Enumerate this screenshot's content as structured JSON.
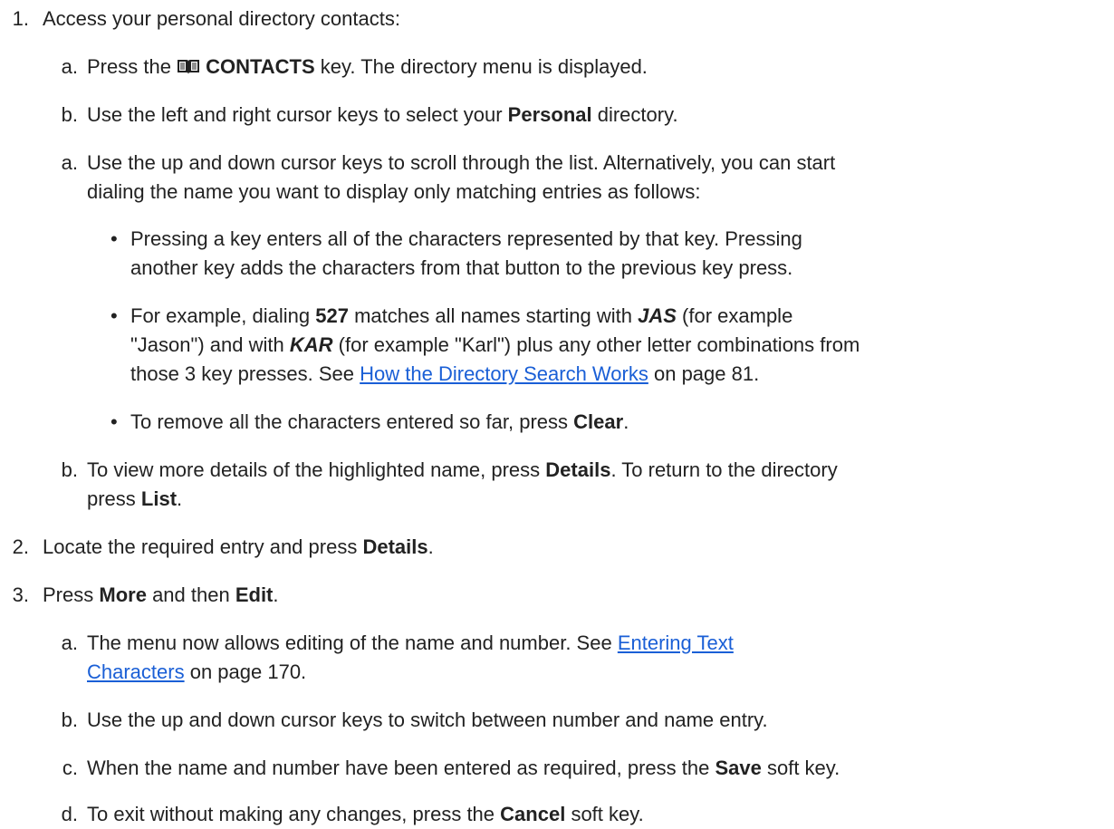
{
  "steps": {
    "s1": {
      "num": "1.",
      "text": "Access your personal directory contacts:",
      "a": {
        "letter": "a.",
        "pre": "Press the",
        "key": "CONTACTS",
        "post": "key. The directory menu is displayed."
      },
      "b": {
        "letter": "b.",
        "pre": "Use the left and right cursor keys to select your",
        "bold": "Personal",
        "post": "directory."
      },
      "c": {
        "letter": "a.",
        "line1": "Use the up and down cursor keys to scroll through the list. Alternatively, you can start",
        "line2": "dialing the name you want to display only matching entries as follows:",
        "bullets": {
          "one": {
            "line1": "Pressing a key enters all of the characters represented by that key. Pressing",
            "line2": "another key adds the characters from that button to the previous key press."
          },
          "two": {
            "l1_a": "For example, dialing",
            "l1_b": "527",
            "l1_c": "matches all names starting with",
            "l1_d": "JAS",
            "l1_e": "(for example",
            "l2_a": "\"Jason\") and with",
            "l2_b": "KAR",
            "l2_c": "(for example \"Karl\") plus any other letter combinations from",
            "l3_a": "those 3 key presses. See",
            "l3_link": "How the Directory Search Works",
            "l3_c": "on page 81."
          },
          "three": {
            "pre": "To remove all the characters entered so far, press",
            "bold": "Clear",
            "post": "."
          }
        }
      },
      "d": {
        "letter": "b.",
        "l1_pre": "To view more details of the highlighted name, press",
        "l1_bold": "Details",
        "l1_post": ". To return to the directory",
        "l2_pre": "press",
        "l2_bold": "List",
        "l2_post": "."
      }
    },
    "s2": {
      "num": "2.",
      "pre": "Locate the required entry and press",
      "bold": "Details",
      "post": "."
    },
    "s3": {
      "num": "3.",
      "pre": "Press",
      "bold1": "More",
      "mid": "and then",
      "bold2": "Edit",
      "post": ".",
      "a": {
        "letter": "a.",
        "l1_pre": "The menu now allows editing of the name and number. See",
        "l1_link": "Entering Text",
        "l2_link": "Characters",
        "l2_post": "on page 170."
      },
      "b": {
        "letter": "b.",
        "text": "Use the up and down cursor keys to switch between number and name entry."
      },
      "c": {
        "letter": "c.",
        "pre": "When the name and number have been entered as required, press the",
        "bold": "Save",
        "post": "soft key."
      },
      "d": {
        "letter": "d.",
        "pre": "To exit without making any changes, press the",
        "bold": "Cancel",
        "post": "soft key."
      }
    }
  },
  "bullet_glyph": "•",
  "colors": {
    "text": "#222222",
    "link": "#1a5fd6"
  },
  "icons": {
    "contacts_key": "open-book-icon"
  }
}
